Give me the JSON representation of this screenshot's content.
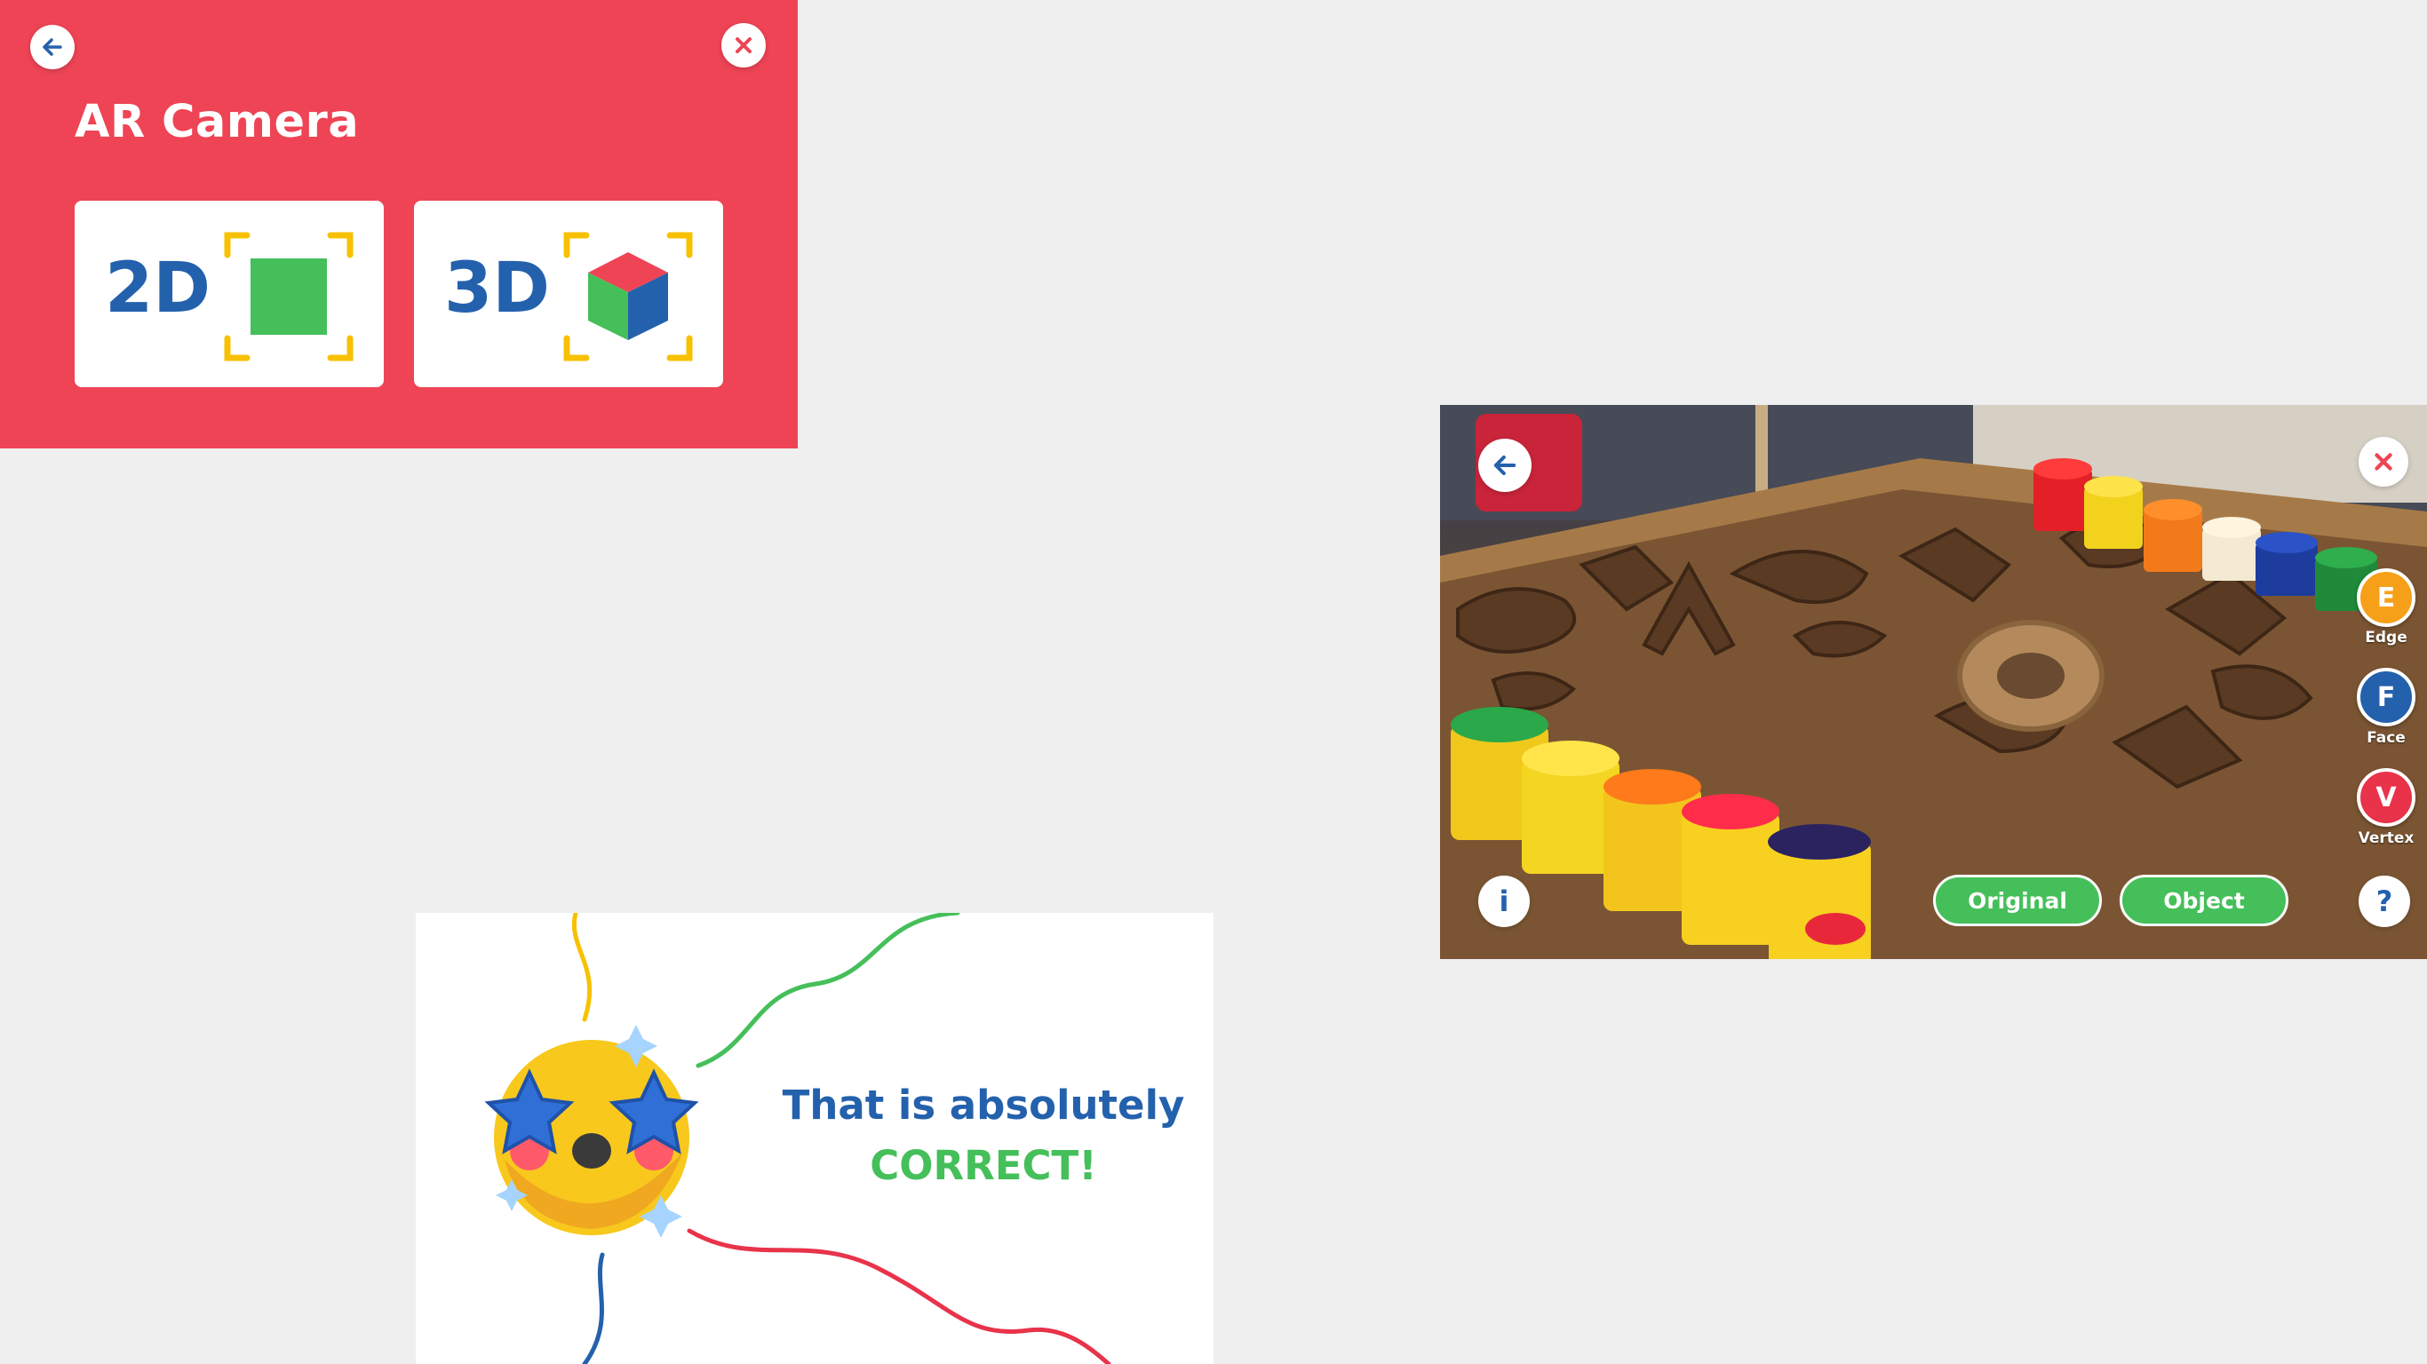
{
  "ar_menu": {
    "title": "AR Camera",
    "modes": [
      {
        "label": "2D"
      },
      {
        "label": "3D"
      }
    ]
  },
  "ar_view": {
    "side_tools": [
      {
        "letter": "E",
        "caption": "Edge"
      },
      {
        "letter": "F",
        "caption": "Face"
      },
      {
        "letter": "V",
        "caption": "Vertex"
      }
    ],
    "view_buttons": [
      {
        "label": "Original"
      },
      {
        "label": "Object"
      }
    ],
    "info_symbol": "i",
    "help_symbol": "?"
  },
  "feedback": {
    "line1": "That is absolutely",
    "line2": "CORRECT!"
  },
  "colors": {
    "panel_red": "#ee4455",
    "primary_blue": "#2461ad",
    "success_green": "#45bf5a",
    "accent_yellow": "#f8c100",
    "edge_orange": "#f6a01a",
    "vertex_red": "#e8334a"
  }
}
